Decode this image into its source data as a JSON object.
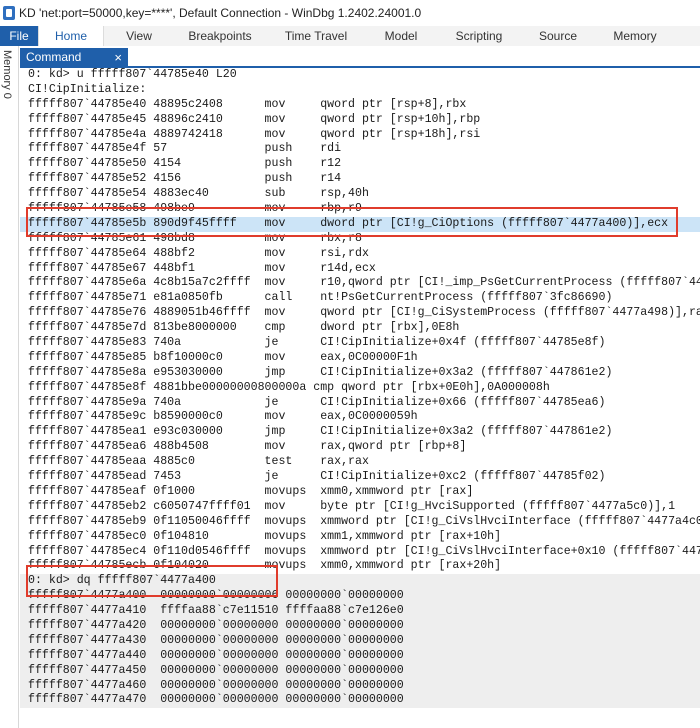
{
  "window": {
    "title": "KD 'net:port=50000,key=****', Default Connection  - WinDbg 1.2402.24001.0"
  },
  "ribbon": {
    "tabs": [
      "File",
      "Home",
      "View",
      "Breakpoints",
      "Time Travel",
      "Model",
      "Scripting",
      "Source",
      "Memory"
    ],
    "active": "Home"
  },
  "left_panel": {
    "label": "Memory 0"
  },
  "command_window": {
    "title": "Command",
    "close": "×"
  },
  "output_lines": [
    "0: kd> u fffff807`44785e40 L20",
    "CI!CipInitialize:",
    "fffff807`44785e40 48895c2408      mov     qword ptr [rsp+8],rbx",
    "fffff807`44785e45 48896c2410      mov     qword ptr [rsp+10h],rbp",
    "fffff807`44785e4a 4889742418      mov     qword ptr [rsp+18h],rsi",
    "fffff807`44785e4f 57              push    rdi",
    "fffff807`44785e50 4154            push    r12",
    "fffff807`44785e52 4156            push    r14",
    "fffff807`44785e54 4883ec40        sub     rsp,40h",
    "fffff807`44785e58 498be9          mov     rbp,r9",
    "fffff807`44785e5b 890d9f45ffff    mov     dword ptr [CI!g_CiOptions (fffff807`4477a400)],ecx",
    "fffff807`44785e61 498bd8          mov     rbx,r8",
    "fffff807`44785e64 488bf2          mov     rsi,rdx",
    "fffff807`44785e67 448bf1          mov     r14d,ecx",
    "fffff807`44785e6a 4c8b15a7c2ffff  mov     r10,qword ptr [CI!_imp_PsGetCurrentProcess (fffff807`4477",
    "fffff807`44785e71 e81a0850fb      call    nt!PsGetCurrentProcess (fffff807`3fc86690)",
    "fffff807`44785e76 4889051b46ffff  mov     qword ptr [CI!g_CiSystemProcess (fffff807`4477a498)],ra",
    "fffff807`44785e7d 813be8000000    cmp     dword ptr [rbx],0E8h",
    "fffff807`44785e83 740a            je      CI!CipInitialize+0x4f (fffff807`44785e8f)",
    "fffff807`44785e85 b8f10000c0      mov     eax,0C00000F1h",
    "fffff807`44785e8a e953030000      jmp     CI!CipInitialize+0x3a2 (fffff807`447861e2)",
    "fffff807`44785e8f 4881bbe00000000800000a cmp qword ptr [rbx+0E0h],0A000008h",
    "fffff807`44785e9a 740a            je      CI!CipInitialize+0x66 (fffff807`44785ea6)",
    "fffff807`44785e9c b8590000c0      mov     eax,0C0000059h",
    "fffff807`44785ea1 e93c030000      jmp     CI!CipInitialize+0x3a2 (fffff807`447861e2)",
    "fffff807`44785ea6 488b4508        mov     rax,qword ptr [rbp+8]",
    "fffff807`44785eaa 4885c0          test    rax,rax",
    "fffff807`44785ead 7453            je      CI!CipInitialize+0xc2 (fffff807`44785f02)",
    "fffff807`44785eaf 0f1000          movups  xmm0,xmmword ptr [rax]",
    "fffff807`44785eb2 c6050747ffff01  mov     byte ptr [CI!g_HvciSupported (fffff807`4477a5c0)],1",
    "fffff807`44785eb9 0f11050046ffff  movups  xmmword ptr [CI!g_CiVslHvciInterface (fffff807`4477a4c0",
    "fffff807`44785ec0 0f104810        movups  xmm1,xmmword ptr [rax+10h]",
    "fffff807`44785ec4 0f110d0546ffff  movups  xmmword ptr [CI!g_CiVslHvciInterface+0x10 (fffff807`447",
    "fffff807`44785ecb 0f104020        movups  xmm0,xmmword ptr [rax+20h]",
    "0: kd> dq fffff807`4477a400",
    "fffff807`4477a400  00000000`00000006 00000000`00000000",
    "fffff807`4477a410  ffffaa88`c7e11510 ffffaa88`c7e126e0",
    "fffff807`4477a420  00000000`00000000 00000000`00000000",
    "fffff807`4477a430  00000000`00000000 00000000`00000000",
    "fffff807`4477a440  00000000`00000000 00000000`00000000",
    "fffff807`4477a450  00000000`00000000 00000000`00000000",
    "fffff807`4477a460  00000000`00000000 00000000`00000000",
    "fffff807`4477a470  00000000`00000000 00000000`00000000"
  ],
  "colors": {
    "accent": "#1f5faa",
    "highlight_box": "#e03c2c",
    "selection": "#cce4f7"
  }
}
